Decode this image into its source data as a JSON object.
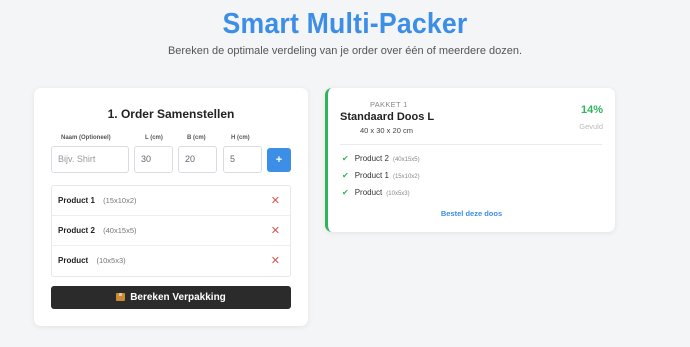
{
  "header": {
    "title": "Smart Multi-Packer",
    "subtitle": "Bereken de optimale verdeling van je order over één of meerdere dozen."
  },
  "order": {
    "title": "1. Order Samenstellen",
    "labels": {
      "name": "Naam (Optioneel)",
      "length": "L (cm)",
      "width": "B (cm)",
      "height": "H (cm)"
    },
    "inputs": {
      "name_placeholder": "Bijv. Shirt",
      "length": "30",
      "width": "20",
      "height": "5"
    },
    "add_button": "+",
    "products": [
      {
        "name": "Product 1",
        "dims": "(15x10x2)",
        "remove": "✕"
      },
      {
        "name": "Product 2",
        "dims": "(40x15x5)",
        "remove": "✕"
      },
      {
        "name": "Product",
        "dims": "(10x5x3)",
        "remove": "✕"
      }
    ],
    "calculate_button": "Bereken Verpakking",
    "calculate_icon": "package-icon"
  },
  "result": {
    "package_label": "PAKKET 1",
    "box_name": "Standaard Doos L",
    "box_dims": "40 x 30 x 20 cm",
    "fill_percent": "14%",
    "fill_label": "Gevuld",
    "items": [
      {
        "name": "Product 2",
        "dims": "(40x15x5)"
      },
      {
        "name": "Product 1",
        "dims": "(15x10x2)"
      },
      {
        "name": "Product",
        "dims": "(10x5x3)"
      }
    ],
    "order_link": "Bestel deze doos",
    "accent_color": "#31b35a"
  },
  "colors": {
    "brand": "#3d8ee6",
    "success": "#31b35a",
    "danger": "#e0524c",
    "dark_button": "#2b2b2b"
  }
}
